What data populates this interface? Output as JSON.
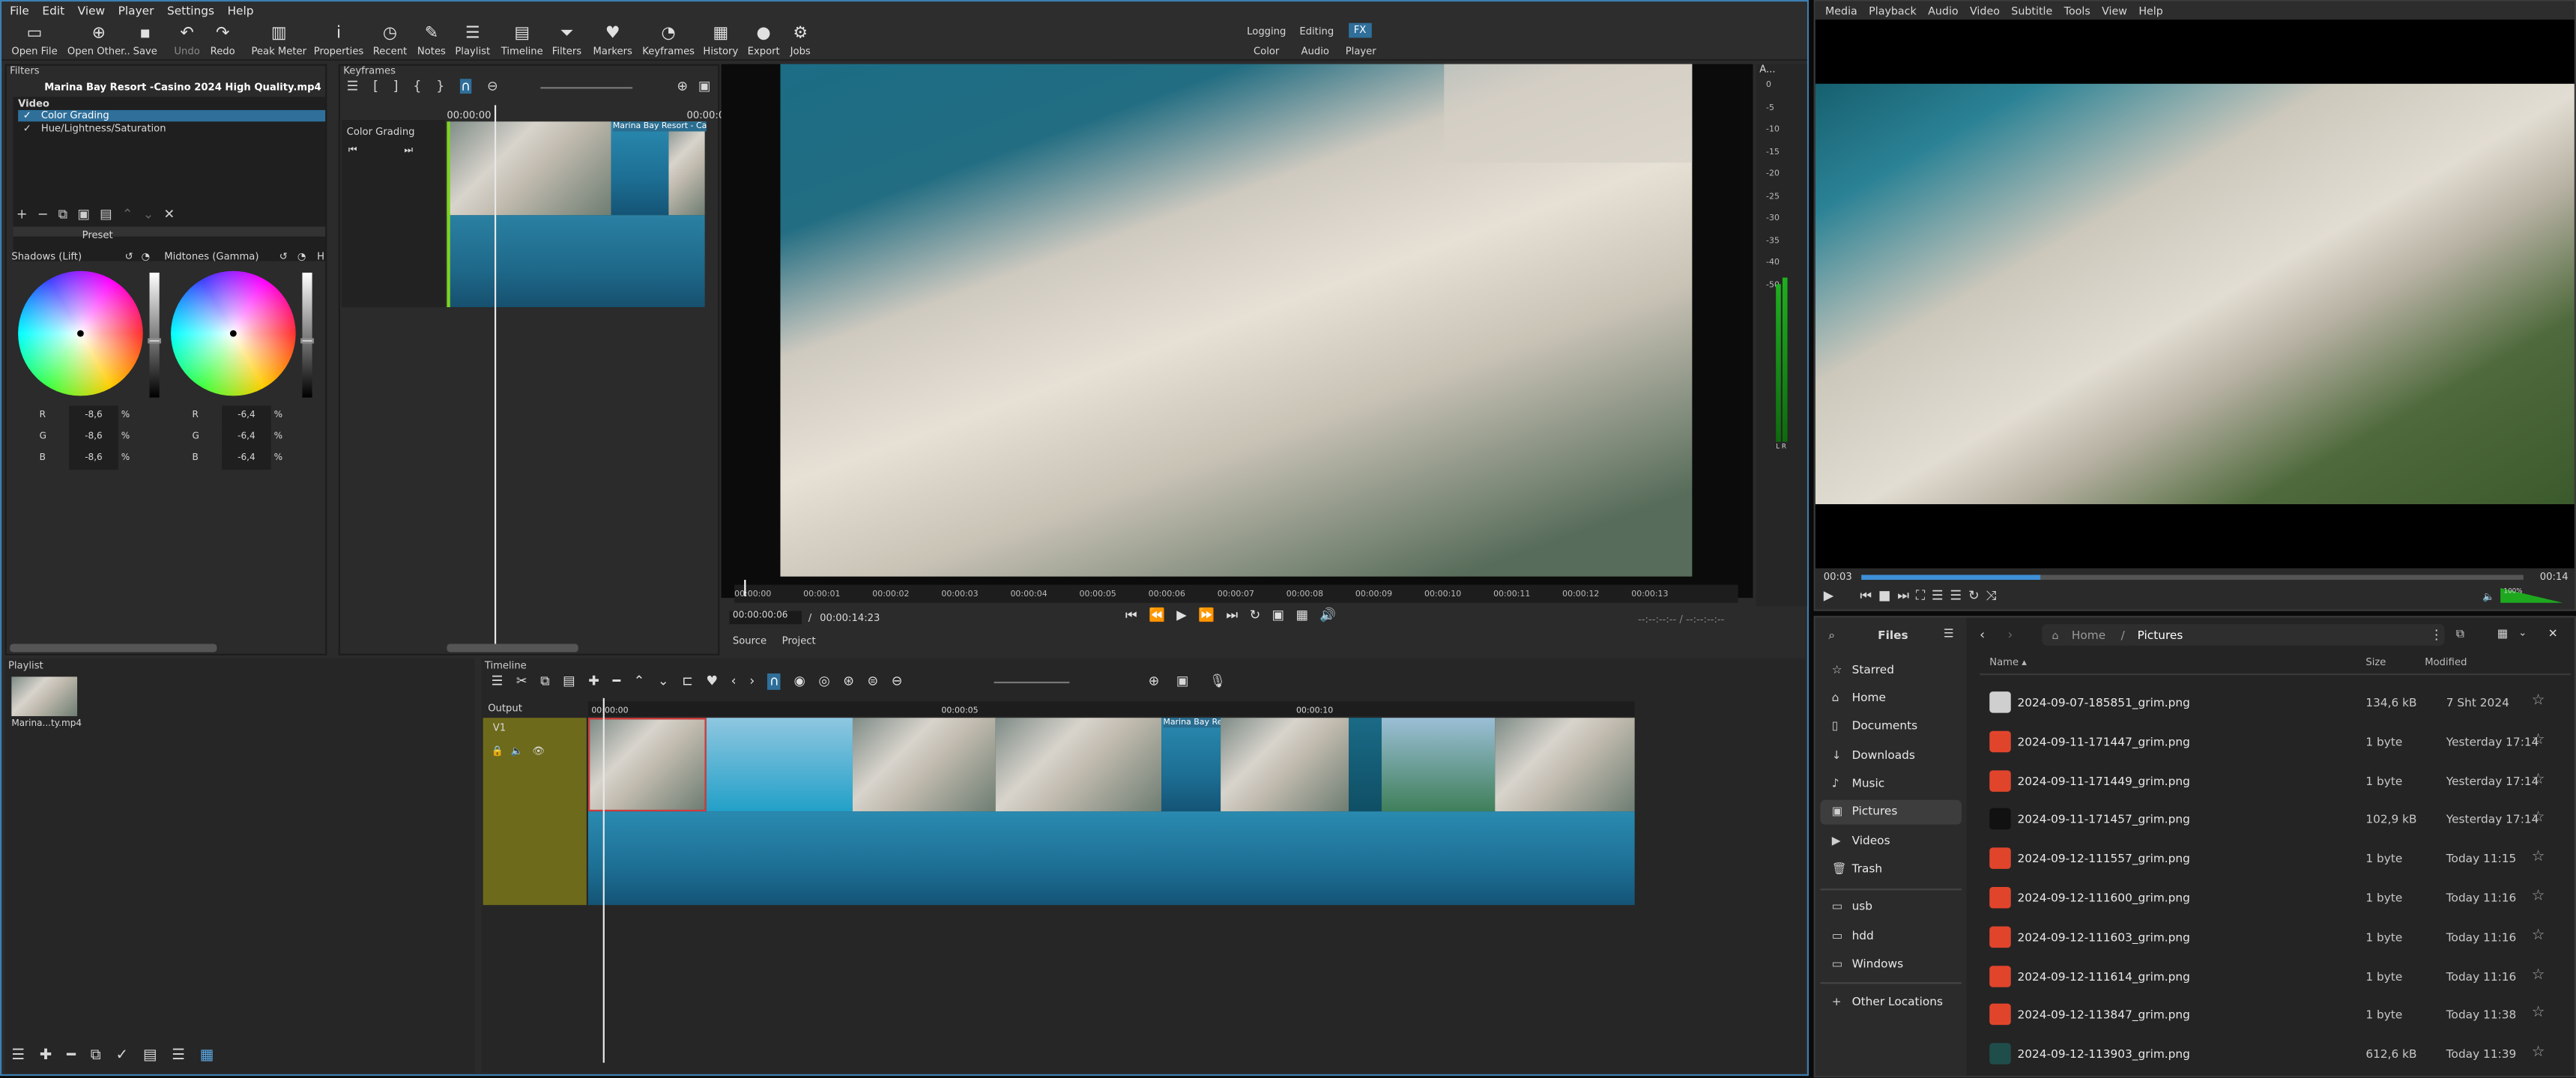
{
  "shotcut": {
    "menu": [
      "File",
      "Edit",
      "View",
      "Player",
      "Settings",
      "Help"
    ],
    "toolbar": [
      {
        "label": "Open File",
        "icon": "open-file-icon"
      },
      {
        "label": "Open Other..",
        "icon": "open-other-icon"
      },
      {
        "label": "Save",
        "icon": "save-icon"
      },
      {
        "label": "Undo",
        "icon": "undo-icon"
      },
      {
        "label": "Redo",
        "icon": "redo-icon"
      },
      {
        "label": "Peak Meter",
        "icon": "peak-meter-icon"
      },
      {
        "label": "Properties",
        "icon": "properties-icon"
      },
      {
        "label": "Recent",
        "icon": "recent-icon"
      },
      {
        "label": "Notes",
        "icon": "notes-icon"
      },
      {
        "label": "Playlist",
        "icon": "playlist-icon"
      },
      {
        "label": "Timeline",
        "icon": "timeline-icon"
      },
      {
        "label": "Filters",
        "icon": "filters-icon"
      },
      {
        "label": "Markers",
        "icon": "markers-icon"
      },
      {
        "label": "Keyframes",
        "icon": "keyframes-icon"
      },
      {
        "label": "History",
        "icon": "history-icon"
      },
      {
        "label": "Export",
        "icon": "export-icon"
      },
      {
        "label": "Jobs",
        "icon": "jobs-icon"
      }
    ],
    "layouts": {
      "row1": [
        "Logging",
        "Editing",
        "FX"
      ],
      "row2": [
        "Color",
        "Audio",
        "Player"
      ],
      "active": "FX"
    },
    "filters": {
      "title": "Filters",
      "clip_name": "Marina Bay Resort -Casino 2024 High Quality.mp4",
      "section": "Video",
      "items": [
        {
          "label": "Color Grading",
          "checked": true,
          "selected": true
        },
        {
          "label": "Hue/Lightness/Saturation",
          "checked": true,
          "selected": false
        }
      ],
      "preset_label": "Preset",
      "shadows_label": "Shadows (Lift)",
      "midtones_label": "Midtones (Gamma)",
      "highlights_label": "H",
      "shadows": {
        "R": "-8,6",
        "G": "-8,6",
        "B": "-8,6"
      },
      "midtones": {
        "R": "-6,4",
        "G": "-6,4",
        "B": "-6,4"
      },
      "unit": "%"
    },
    "keyframes": {
      "title": "Keyframes",
      "time_start": "00:00:00",
      "time_end": "00:00:0",
      "filter_label": "Color Grading",
      "clip_label": "Marina Bay Resort - Ca"
    },
    "player": {
      "ruler": [
        "00:00:00",
        "00:00:01",
        "00:00:02",
        "00:00:03",
        "00:00:04",
        "00:00:05",
        "00:00:06",
        "00:00:07",
        "00:00:08",
        "00:00:09",
        "00:00:10",
        "00:00:11",
        "00:00:12",
        "00:00:13"
      ],
      "current": "00:00:00:06",
      "separator": "/",
      "duration": "00:00:14:23",
      "in_out": "--:--:--:-- / --:--:--:--",
      "tabs": [
        "Source",
        "Project"
      ]
    },
    "meter": {
      "scale": [
        "0",
        "-5",
        "-10",
        "-15",
        "-20",
        "-25",
        "-30",
        "-35",
        "-40",
        "-50"
      ],
      "channels": "L R",
      "label": "A..."
    },
    "playlist": {
      "title": "Playlist",
      "item": "Marina...ty.mp4"
    },
    "timeline": {
      "title": "Timeline",
      "output_label": "Output",
      "track": "V1",
      "ticks": [
        "00:00:00",
        "00:00:05",
        "00:00:10"
      ],
      "clip_label": "Marina Bay Re"
    }
  },
  "vlc": {
    "menu": [
      "Media",
      "Playback",
      "Audio",
      "Video",
      "Subtitle",
      "Tools",
      "View",
      "Help"
    ],
    "time_elapsed": "00:03",
    "time_total": "00:14",
    "volume": "100%",
    "progress": 0.27
  },
  "files": {
    "title": "Files",
    "breadcrumb": [
      "Home",
      "Pictures"
    ],
    "sidebar": [
      {
        "label": "Starred",
        "icon": "star-icon"
      },
      {
        "label": "Home",
        "icon": "home-icon"
      },
      {
        "label": "Documents",
        "icon": "document-icon"
      },
      {
        "label": "Downloads",
        "icon": "download-icon"
      },
      {
        "label": "Music",
        "icon": "music-icon"
      },
      {
        "label": "Pictures",
        "icon": "picture-icon",
        "active": true
      },
      {
        "label": "Videos",
        "icon": "video-icon"
      },
      {
        "label": "Trash",
        "icon": "trash-icon"
      }
    ],
    "devices": [
      {
        "label": "usb",
        "icon": "folder-icon"
      },
      {
        "label": "hdd",
        "icon": "folder-icon"
      },
      {
        "label": "Windows",
        "icon": "folder-icon"
      }
    ],
    "other": "Other Locations",
    "columns": {
      "name": "Name",
      "size": "Size",
      "modified": "Modified"
    },
    "rows": [
      {
        "name": "2024-09-07-185851_grim.png",
        "size": "134,6 kB",
        "modified": "7 Sht 2024",
        "thumb": "#cfcfcf"
      },
      {
        "name": "2024-09-11-171447_grim.png",
        "size": "1 byte",
        "modified": "Yesterday 17:14",
        "thumb": "#e0452c"
      },
      {
        "name": "2024-09-11-171449_grim.png",
        "size": "1 byte",
        "modified": "Yesterday 17:14",
        "thumb": "#e0452c"
      },
      {
        "name": "2024-09-11-171457_grim.png",
        "size": "102,9 kB",
        "modified": "Yesterday 17:14",
        "thumb": "#111111"
      },
      {
        "name": "2024-09-12-111557_grim.png",
        "size": "1 byte",
        "modified": "Today 11:15",
        "thumb": "#e0452c"
      },
      {
        "name": "2024-09-12-111600_grim.png",
        "size": "1 byte",
        "modified": "Today 11:16",
        "thumb": "#e0452c"
      },
      {
        "name": "2024-09-12-111603_grim.png",
        "size": "1 byte",
        "modified": "Today 11:16",
        "thumb": "#e0452c"
      },
      {
        "name": "2024-09-12-111614_grim.png",
        "size": "1 byte",
        "modified": "Today 11:16",
        "thumb": "#e0452c"
      },
      {
        "name": "2024-09-12-113847_grim.png",
        "size": "1 byte",
        "modified": "Today 11:38",
        "thumb": "#e0452c"
      },
      {
        "name": "2024-09-12-113903_grim.png",
        "size": "612,6 kB",
        "modified": "Today 11:39",
        "thumb": "#1f4d4a"
      }
    ]
  }
}
